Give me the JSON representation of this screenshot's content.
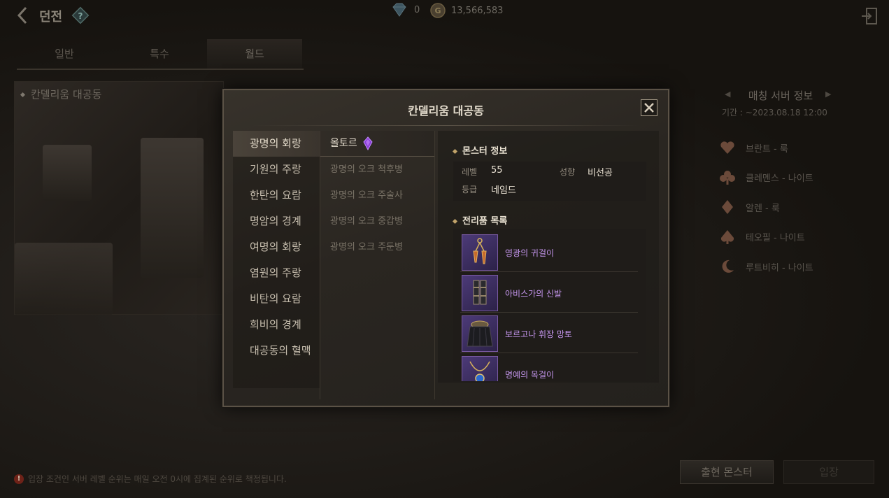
{
  "header": {
    "back_icon": "chevron-left-icon",
    "title": "던전",
    "help_icon": "question-icon",
    "gems": "0",
    "gold": "13,566,583",
    "exit_icon": "exit-icon"
  },
  "tabs": [
    {
      "label": "일반"
    },
    {
      "label": "특수"
    },
    {
      "label": "월드"
    }
  ],
  "background": {
    "dungeon_name": "칸델리움 대공동",
    "server_info": {
      "title": "매칭 서버 정보",
      "period": "기간 : ~2023.08.18 12:00",
      "servers": [
        {
          "name": "브란트 - 룩",
          "icon": "heart-icon",
          "color": "#6b4a3a"
        },
        {
          "name": "클레멘스 - 나이트",
          "icon": "club-icon",
          "color": "#6b4a3a"
        },
        {
          "name": "알렌 - 룩",
          "icon": "diamond-icon",
          "color": "#6b4a3a"
        },
        {
          "name": "테오필 - 나이트",
          "icon": "spade-icon",
          "color": "#6b4a3a"
        },
        {
          "name": "루트비히 - 나이트",
          "icon": "moon-icon",
          "color": "#6b4a3a"
        }
      ]
    },
    "notice": "입장 조건인 서버 레벨 순위는 매일 오전 0시에 집계된 순위로 책정됩니다.",
    "appear_monster_button": "출현 몬스터",
    "enter_button": "입장"
  },
  "modal": {
    "title": "칸델리움 대공동",
    "floors": [
      "광명의 회랑",
      "기원의 주랑",
      "한탄의 요람",
      "명암의 경계",
      "여명의 회랑",
      "염원의 주랑",
      "비탄의 요람",
      "희비의 경계",
      "대공동의 혈맥"
    ],
    "monsters": [
      "올토르",
      "광명의 오크 척후병",
      "광명의 오크 주술사",
      "광명의 오크 중갑병",
      "광명의 오크 주둔병"
    ],
    "monster_info": {
      "heading": "몬스터 정보",
      "level_label": "레벨",
      "level_value": "55",
      "tendency_label": "성향",
      "tendency_value": "비선공",
      "grade_label": "등급",
      "grade_value": "네임드"
    },
    "loot": {
      "heading": "전리품 목록",
      "items": [
        {
          "name": "영광의 귀걸이",
          "icon": "earring-icon"
        },
        {
          "name": "아비스가의 신발",
          "icon": "boots-icon"
        },
        {
          "name": "보르고나 휘장 망토",
          "icon": "cloak-icon"
        },
        {
          "name": "명예의 목걸이",
          "icon": "necklace-icon"
        }
      ]
    },
    "item_name_color": "#c596ee"
  }
}
